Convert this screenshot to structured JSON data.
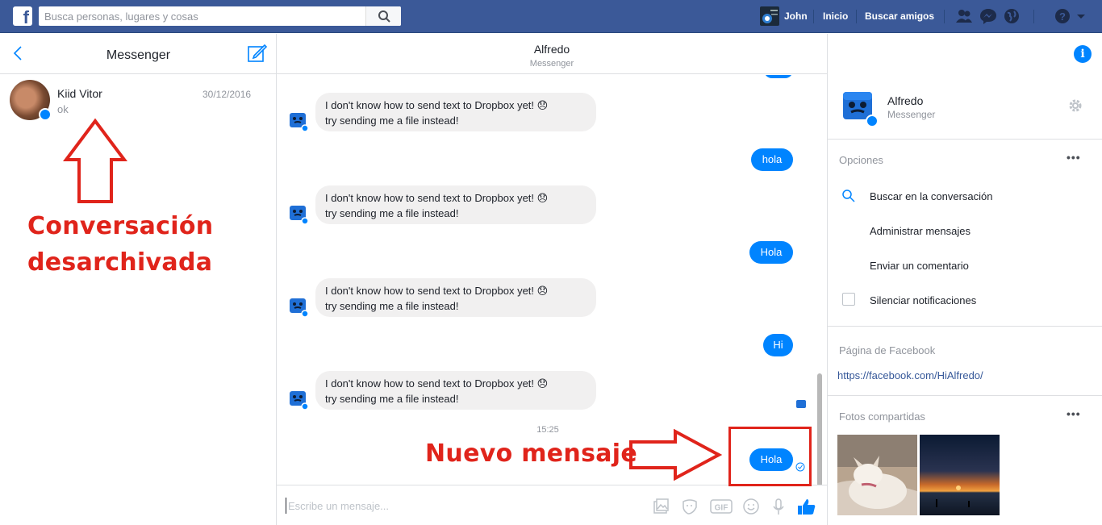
{
  "topbar": {
    "logo": "f",
    "search_placeholder": "Busca personas, lugares y cosas",
    "user_name": "John",
    "home": "Inicio",
    "find_friends": "Buscar amigos"
  },
  "left": {
    "title": "Messenger",
    "conversation": {
      "name": "Kiid Vitor",
      "snippet": "ok",
      "date": "30/12/2016"
    },
    "annotation_line1": "Conversación",
    "annotation_line2": "desarchivada"
  },
  "chat": {
    "contact": "Alfredo",
    "subtitle": "Messenger",
    "bot_line1": "I don't know how to send text to Dropbox yet! 😞",
    "bot_line2": "try sending me a file instead!",
    "out1": "hola",
    "out2": "Hola",
    "out3": "Hi",
    "timestamp": "15:25",
    "new_msg": "Hola",
    "annotation": "Nuevo mensaje",
    "composer_placeholder": "Escribe un mensaje..."
  },
  "info": {
    "name": "Alfredo",
    "sub": "Messenger",
    "options_title": "Opciones",
    "options": [
      "Buscar en la conversación",
      "Administrar mensajes",
      "Enviar un comentario",
      "Silenciar notificaciones"
    ],
    "page_title": "Página de Facebook",
    "page_url": "https://facebook.com/HiAlfredo/",
    "photos_title": "Fotos compartidas"
  },
  "colors": {
    "brand": "#3b5998",
    "messenger_blue": "#0084ff",
    "annotation_red": "#e0241b"
  }
}
